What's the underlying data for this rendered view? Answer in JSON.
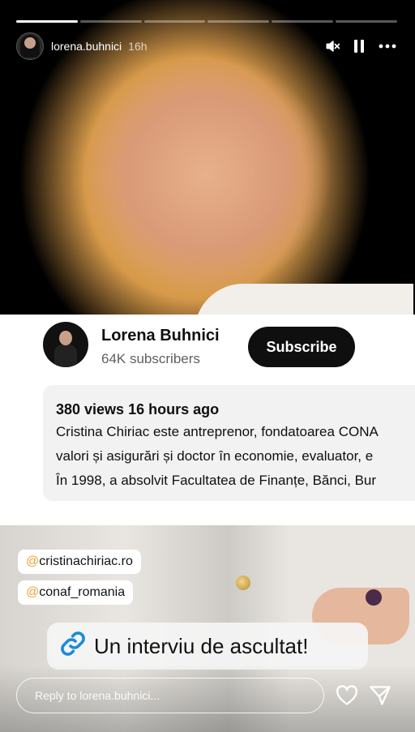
{
  "story": {
    "progress_segments": 6,
    "active_segment": 1,
    "header": {
      "username": "lorena.buhnici",
      "time": "16h",
      "icons": [
        "mute-icon",
        "pause-icon",
        "more-icon"
      ]
    }
  },
  "youtube_card": {
    "channel_name": "Lorena Buhnici",
    "subscribers": "64K subscribers",
    "subscribe_label": "Subscribe",
    "description": {
      "meta": "380 views  16 hours ago",
      "lines": [
        "Cristina Chiriac este antreprenor, fondatoarea CONA",
        "valori și asigurări și doctor în economie, evaluator, e",
        "În 1998, a absolvit Facultatea de Finanțe, Bănci, Bur"
      ]
    }
  },
  "stickers": {
    "mentions": [
      "cristinachiriac.ro",
      "conaf_romania"
    ],
    "mention_prefix": "@",
    "link_text": "Un interviu de ascultat!",
    "link_icon": "link-icon"
  },
  "reply": {
    "placeholder": "Reply to lorena.buhnici..."
  },
  "colors": {
    "subscribe_bg": "#0f0f0f",
    "mention_at": "#e8a33a",
    "link_icon": "#1a8cd8"
  }
}
